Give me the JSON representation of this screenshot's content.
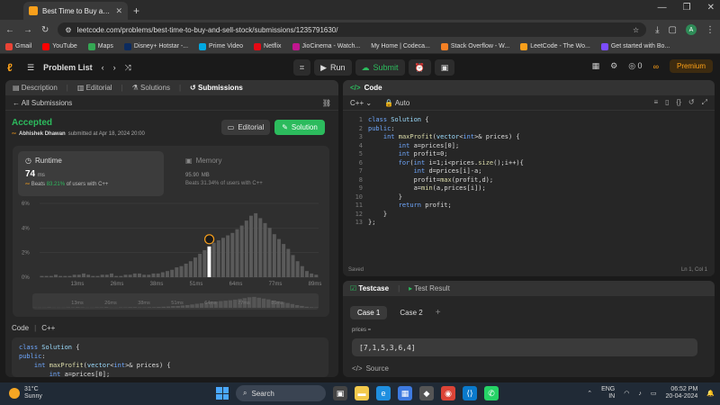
{
  "browser": {
    "tab_title": "Best Time to Buy and Sell Stock",
    "url": "leetcode.com/problems/best-time-to-buy-and-sell-stock/submissions/1235791630/",
    "avatar_letter": "A",
    "bookmarks": [
      "Gmail",
      "YouTube",
      "Maps",
      "Disney+ Hotstar -...",
      "Prime Video",
      "Netflix",
      "JioCinema - Watch...",
      "My Home | Codeca...",
      "Stack Overflow - W...",
      "LeetCode - The Wo...",
      "Get started with Bo..."
    ]
  },
  "lcnav": {
    "problem_list": "Problem List",
    "run": "Run",
    "submit": "Submit",
    "streak_count": "0",
    "premium": "Premium"
  },
  "left": {
    "tabs": [
      "Description",
      "Editorial",
      "Solutions",
      "Submissions"
    ],
    "all_submissions": "All Submissions",
    "status": "Accepted",
    "author": "Abhishek Dhawan",
    "submitted_at": "submitted at Apr 18, 2024 20:00",
    "editorial_btn": "Editorial",
    "solution_btn": "Solution",
    "runtime_label": "Runtime",
    "runtime_value": "74",
    "runtime_unit": "ms",
    "runtime_beats_pre": "Beats",
    "runtime_beats_pct": "83.21%",
    "runtime_beats_post": "of users with C++",
    "memory_label": "Memory",
    "memory_value": "95.90",
    "memory_unit": "MB",
    "memory_beats": "Beats 31.34% of users with C++",
    "code_label": "Code",
    "code_lang": "C++",
    "preview_lines": [
      "class Solution {",
      "public:",
      "    int maxProfit(vector<int>& prices) {",
      "        int a=prices[0];"
    ]
  },
  "chart_data": {
    "type": "bar",
    "ylabels": [
      "6%",
      "4%",
      "2%",
      "0%"
    ],
    "ylim": [
      0,
      6
    ],
    "xlabels": [
      "13ms",
      "26ms",
      "38ms",
      "51ms",
      "64ms",
      "77ms",
      "89ms"
    ],
    "mini_xlabels": [
      "13ms",
      "26ms",
      "38ms",
      "51ms",
      "64ms",
      "77ms",
      "89ms"
    ],
    "values": [
      0.1,
      0.1,
      0.1,
      0.2,
      0.1,
      0.1,
      0.1,
      0.2,
      0.2,
      0.3,
      0.2,
      0.1,
      0.1,
      0.2,
      0.2,
      0.3,
      0.1,
      0.1,
      0.2,
      0.2,
      0.3,
      0.3,
      0.2,
      0.2,
      0.3,
      0.3,
      0.4,
      0.5,
      0.6,
      0.8,
      0.9,
      1.1,
      1.3,
      1.6,
      1.9,
      2.2,
      2.5,
      2.8,
      3.0,
      3.2,
      3.4,
      3.6,
      3.9,
      4.2,
      4.6,
      5.0,
      5.2,
      4.8,
      4.4,
      4.0,
      3.5,
      3.1,
      2.7,
      2.3,
      1.8,
      1.3,
      0.9,
      0.5,
      0.3,
      0.2
    ],
    "highlight_index": 36,
    "highlight_color": "#ffffff",
    "bar_color": "#5a5a5a"
  },
  "right": {
    "code_title": "Code",
    "lang": "C++",
    "mode": "Auto",
    "line_numbers": [
      "1",
      "2",
      "3",
      "4",
      "5",
      "6",
      "7",
      "8",
      "9",
      "10",
      "11",
      "12",
      "13"
    ],
    "saved": "Saved",
    "cursor": "Ln 1, Col 1"
  },
  "tests": {
    "tab_testcase": "Testcase",
    "tab_result": "Test Result",
    "case1": "Case 1",
    "case2": "Case 2",
    "input_label": "prices =",
    "input_value": "[7,1,5,3,6,4]",
    "source": "Source"
  },
  "taskbar": {
    "temp": "31°C",
    "weather": "Sunny",
    "search": "Search",
    "lang1": "ENG",
    "lang2": "IN",
    "time": "06:52 PM",
    "date": "20-04-2024"
  }
}
